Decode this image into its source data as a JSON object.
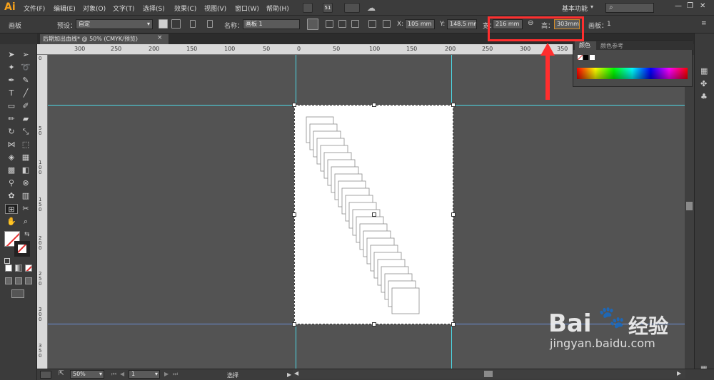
{
  "app": {
    "logo": "Ai",
    "menu": [
      "文件(F)",
      "编辑(E)",
      "对象(O)",
      "文字(T)",
      "选择(S)",
      "效果(C)",
      "视图(V)",
      "窗口(W)",
      "帮助(H)"
    ],
    "toolbar_badge": "51",
    "workspace": "基本功能",
    "window_controls": [
      "—",
      "❐",
      "✕"
    ]
  },
  "control_bar": {
    "mode_label": "画板",
    "preset_label": "预设：",
    "preset_value": "自定",
    "name_label": "名称：",
    "name_value": "画板 1",
    "x_label": "X:",
    "x_value": "105 mm",
    "y_label": "Y:",
    "y_value": "148.5 mm",
    "w_label": "宽：",
    "w_value": "216 mm",
    "h_label": "高：",
    "h_value": "303mm",
    "artboard_label": "画板：",
    "artboard_value": "1"
  },
  "document": {
    "tab_title": "后期加出血线* @ 50% (CMYK/预览)",
    "close_glyph": "×"
  },
  "ruler": {
    "h_ticks": [
      "300",
      "250",
      "200",
      "150",
      "100",
      "50",
      "0",
      "50",
      "100",
      "150",
      "200",
      "250",
      "300",
      "350"
    ],
    "v_ticks": [
      "0",
      "5 0",
      "1 0 0",
      "1 5 0",
      "2 0 0",
      "2 5 0",
      "3 0 0",
      "3 5 0"
    ]
  },
  "color_panel": {
    "tab_color": "颜色",
    "tab_guide": "颜色参考"
  },
  "status": {
    "zoom": "50%",
    "page": "1",
    "tool": "选择"
  },
  "watermark": {
    "brand": "Bai",
    "cn": "经验",
    "url": "jingyan.baidu.com"
  },
  "colors": {
    "guide": "#4dd9e6",
    "highlight": "#ff2e2e",
    "accent": "#f7a21b"
  }
}
